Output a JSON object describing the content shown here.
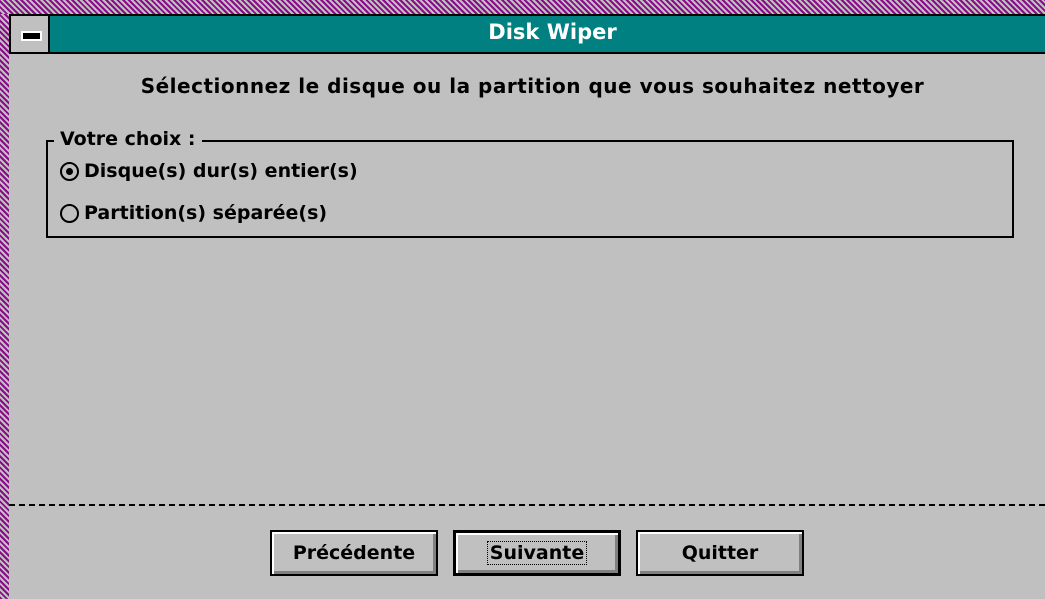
{
  "window": {
    "title": "Disk Wiper"
  },
  "heading": "Sélectionnez le disque ou la partition que vous souhaitez nettoyer",
  "choice_group": {
    "legend": "Votre choix :",
    "options": [
      {
        "label": "Disque(s) dur(s) entier(s)",
        "selected": true
      },
      {
        "label": "Partition(s) séparée(s)",
        "selected": false
      }
    ]
  },
  "buttons": {
    "previous": "Précédente",
    "next": "Suivante",
    "quit": "Quitter"
  },
  "colors": {
    "titlebar": "#008080",
    "face": "#c0c0c0",
    "frame": "#8a0a8a"
  }
}
